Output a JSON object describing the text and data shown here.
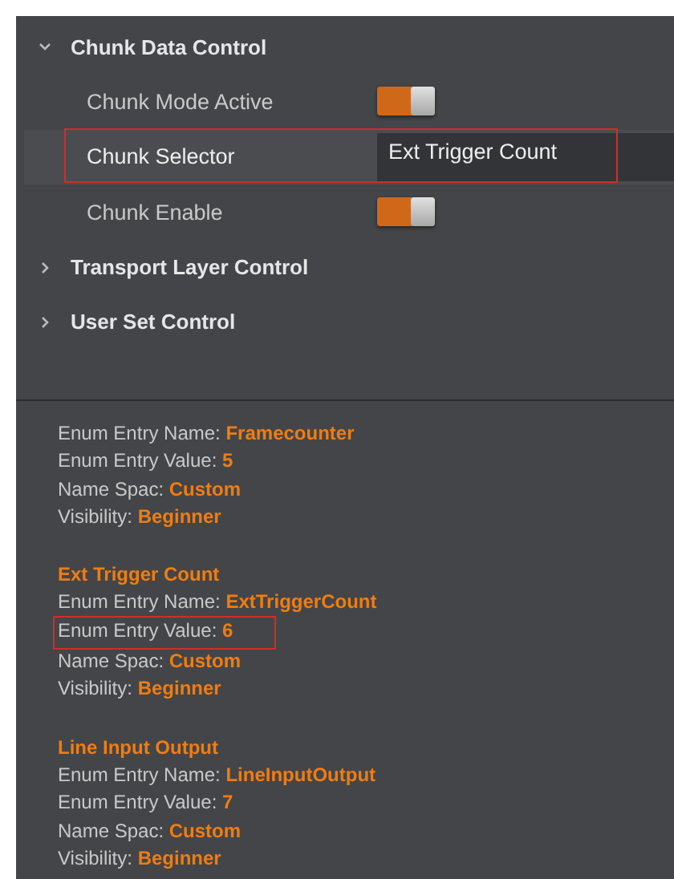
{
  "sections": [
    {
      "title": "Chunk Data Control",
      "expanded": true,
      "children": [
        {
          "kind": "toggle",
          "label": "Chunk Mode Active",
          "on": true,
          "highlighted": false
        },
        {
          "kind": "select",
          "label": "Chunk Selector",
          "value": "Ext Trigger Count",
          "selected": true,
          "highlighted": true
        },
        {
          "kind": "toggle",
          "label": "Chunk Enable",
          "on": true,
          "highlighted": false
        }
      ]
    },
    {
      "title": "Transport Layer Control",
      "expanded": false
    },
    {
      "title": "User Set Control",
      "expanded": false
    }
  ],
  "entries": [
    {
      "fields": [
        {
          "label": "Enum Entry Name:",
          "value": "Framecounter",
          "highlighted": false
        },
        {
          "label": "Enum Entry Value:",
          "value": "5",
          "highlighted": false
        },
        {
          "label": "Name Spac:",
          "value": "Custom",
          "highlighted": false
        },
        {
          "label": "Visibility:",
          "value": "Beginner",
          "highlighted": false
        }
      ]
    },
    {
      "title": "Ext Trigger Count",
      "fields": [
        {
          "label": "Enum Entry Name:",
          "value": "ExtTriggerCount",
          "highlighted": false
        },
        {
          "label": "Enum Entry Value:",
          "value": "6",
          "highlighted": true
        },
        {
          "label": "Name Spac:",
          "value": "Custom",
          "highlighted": false
        },
        {
          "label": "Visibility:",
          "value": "Beginner",
          "highlighted": false
        }
      ]
    },
    {
      "title": "Line Input Output",
      "fields": [
        {
          "label": "Enum Entry Name:",
          "value": "LineInputOutput",
          "highlighted": false
        },
        {
          "label": "Enum Entry Value:",
          "value": "7",
          "highlighted": false
        },
        {
          "label": "Name Spac:",
          "value": "Custom",
          "highlighted": false
        },
        {
          "label": "Visibility:",
          "value": "Beginner",
          "highlighted": false
        }
      ]
    }
  ]
}
